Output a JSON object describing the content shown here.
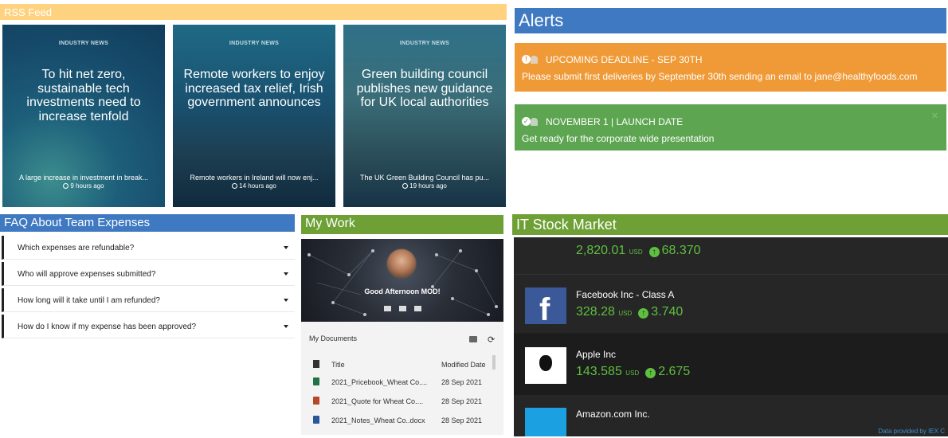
{
  "rss": {
    "header": "RSS Feed",
    "cards": [
      {
        "tag": "INDUSTRY NEWS",
        "title": "To hit net zero, sustainable tech investments need to increase tenfold",
        "summary": "A large increase in investment in break...",
        "time": "9 hours ago"
      },
      {
        "tag": "INDUSTRY NEWS",
        "title": "Remote workers to enjoy increased tax relief, Irish government announces",
        "summary": "Remote workers in Ireland will now enj...",
        "time": "14 hours ago"
      },
      {
        "tag": "INDUSTRY NEWS",
        "title": "Green building council publishes new guidance for UK local authorities",
        "summary": "The UK Green Building Council has pu...",
        "time": "19 hours ago"
      }
    ]
  },
  "alerts": {
    "header": "Alerts",
    "items": [
      {
        "title": "UPCOMING DEADLINE - SEP 30TH",
        "text": "Please submit first deliveries by September 30th sending an email to jane@healthyfoods.com",
        "icon_glyph": "!",
        "color": "#ef9a37"
      },
      {
        "title": "NOVEMBER 1 | LAUNCH DATE",
        "text": "Get ready for the corporate wide presentation",
        "icon_glyph": "✓",
        "color": "#5ea552"
      }
    ],
    "close_glyph": "✕"
  },
  "faq": {
    "header": "FAQ About Team Expenses",
    "items": [
      "Which expenses are refundable?",
      "Who will approve expenses submitted?",
      "How long will it take until I am refunded?",
      "How do I know if my expense has been approved?"
    ]
  },
  "mywork": {
    "header": "My Work",
    "greeting": "Good Afternoon MOD!",
    "documents_title": "My Documents",
    "refresh_glyph": "⟳",
    "columns": {
      "title": "Title",
      "modified": "Modified Date"
    },
    "documents": [
      {
        "name": "2021_Pricebook_Wheat Co....",
        "modified": "28 Sep 2021",
        "icon_color": "#217346"
      },
      {
        "name": "2021_Quote for Wheat Co....",
        "modified": "28 Sep 2021",
        "icon_color": "#b7472a"
      },
      {
        "name": "2021_Notes_Wheat Co..docx",
        "modified": "28 Sep 2021",
        "icon_color": "#2b579a"
      }
    ]
  },
  "stocks": {
    "header": "IT Stock Market",
    "currency": "USD",
    "up_glyph": "↑",
    "items": [
      {
        "name": "",
        "price": "2,820.01",
        "change": "68.370"
      },
      {
        "name": "Facebook Inc - Class A",
        "price": "328.28",
        "change": "3.740"
      },
      {
        "name": "Apple Inc",
        "price": "143.585",
        "change": "2.675"
      },
      {
        "name": "Amazon.com Inc.",
        "price": "",
        "change": ""
      }
    ],
    "facebook_glyph": "f",
    "credit": "Data provided by IEX C"
  }
}
